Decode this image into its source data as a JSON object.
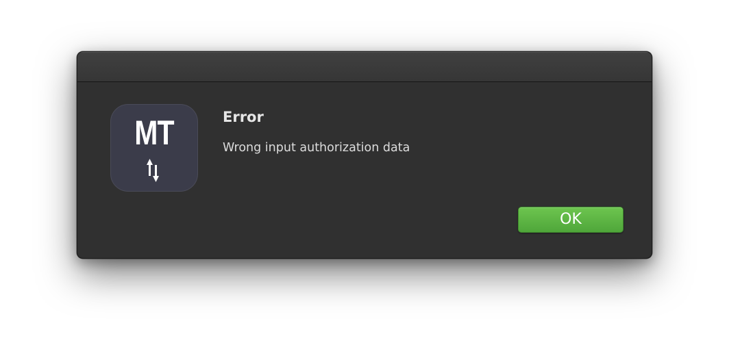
{
  "dialog": {
    "type": "alert",
    "icon": {
      "name": "app-logo-icon",
      "logo_text": "MT",
      "arrows_icon": "up-down-arrows-icon",
      "background_color": "#3b3c4a"
    },
    "title": "Error",
    "message": "Wrong input authorization data",
    "buttons": {
      "ok_label": "OK"
    }
  },
  "colors": {
    "dialog_background": "#303030",
    "titlebar": "#3a3a3a",
    "accent_button": "#5db544",
    "text_primary": "#e6e6e6"
  }
}
